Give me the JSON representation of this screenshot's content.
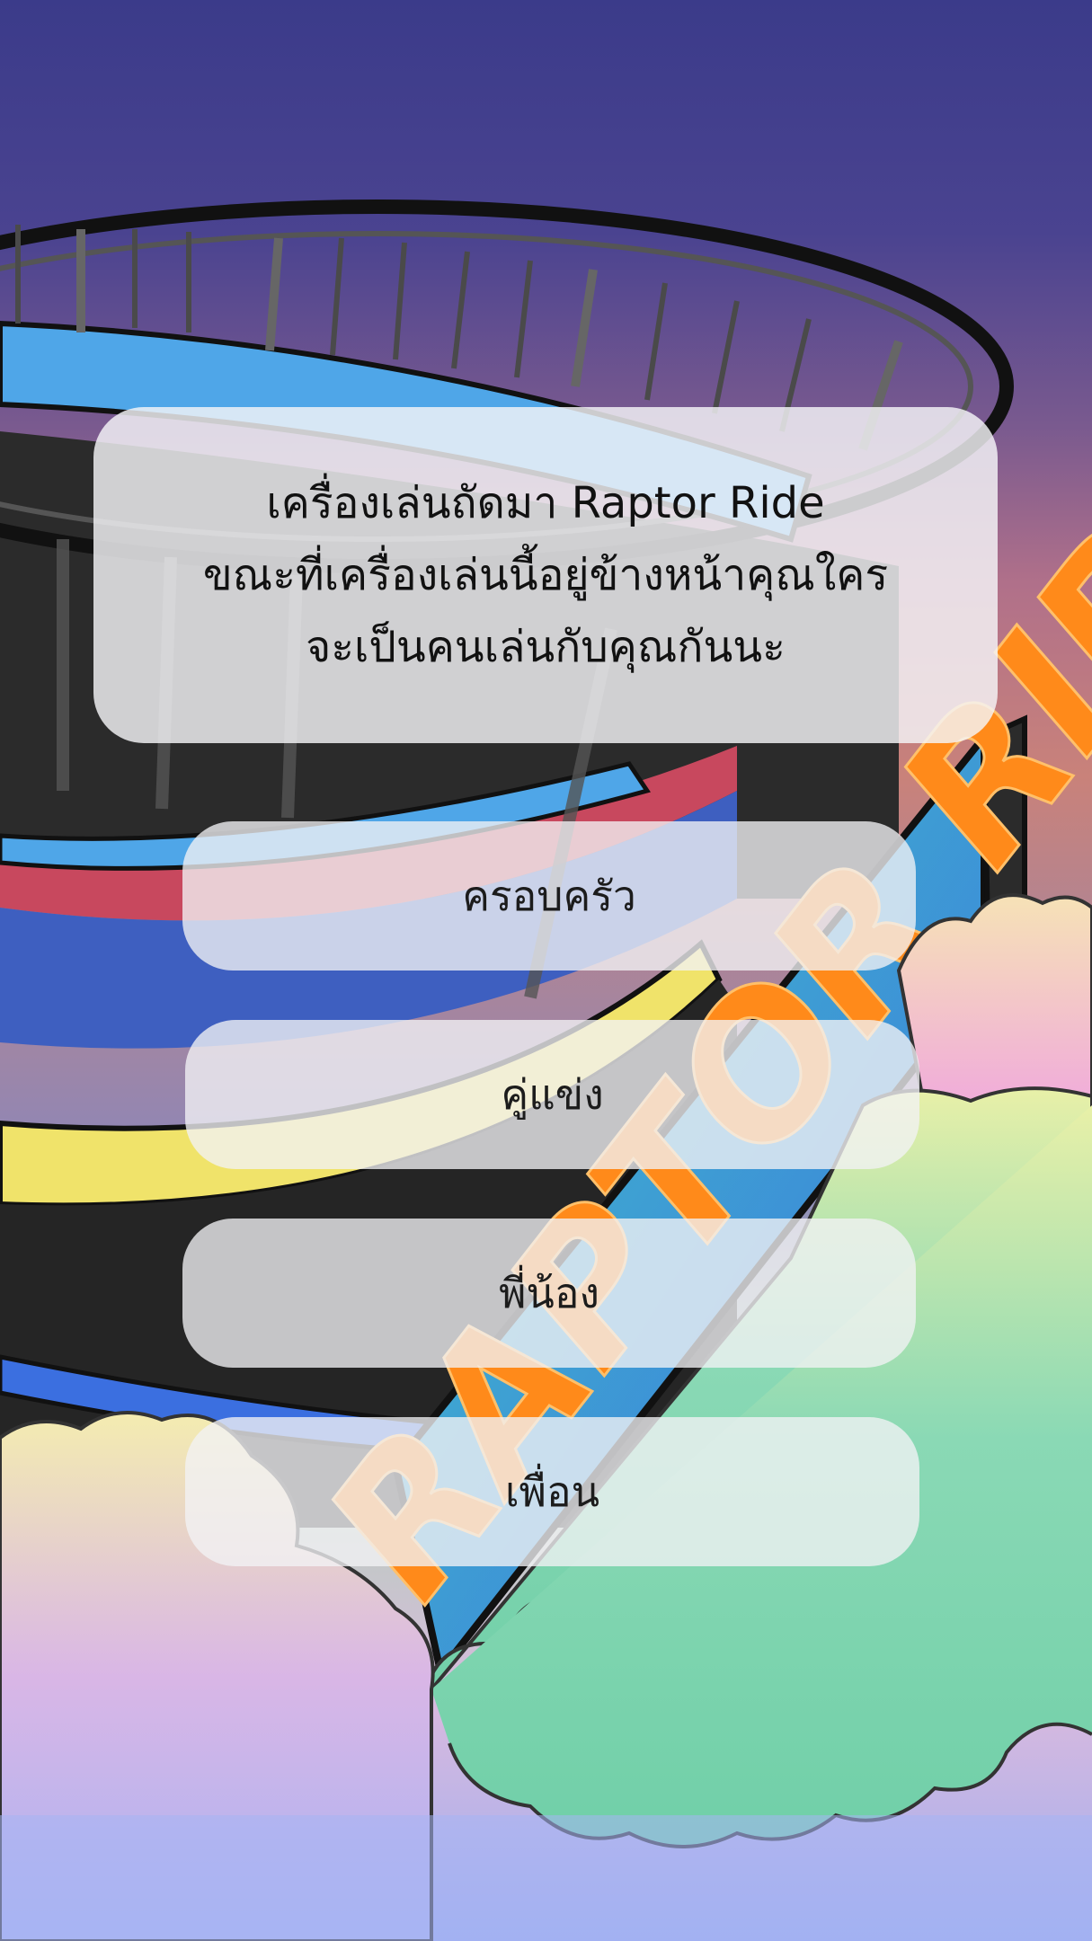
{
  "question": {
    "text": "เครื่องเล่นถัดมา Raptor Ride\nขณะที่เครื่องเล่นนี้อยู่ข้างหน้าคุณใคร\nจะเป็นคนเล่นกับคุณกันนะ"
  },
  "options": [
    {
      "label": "ครอบครัว"
    },
    {
      "label": "คู่แข่ง"
    },
    {
      "label": "พี่น้อง"
    },
    {
      "label": "เพื่อน"
    }
  ],
  "background": {
    "sign_text": "RAPTOR RIDE",
    "colors": {
      "sky_top": "#3b3b8a",
      "ride_dark": "#2a2a2a",
      "ride_blue": "#4a7ae0",
      "ride_yellow": "#f0e060",
      "ride_red": "#c8485e",
      "cloud_green": "#7fd6b0",
      "cloud_pink": "#f2b5dd",
      "sign_orange": "#ff8a1a"
    }
  }
}
